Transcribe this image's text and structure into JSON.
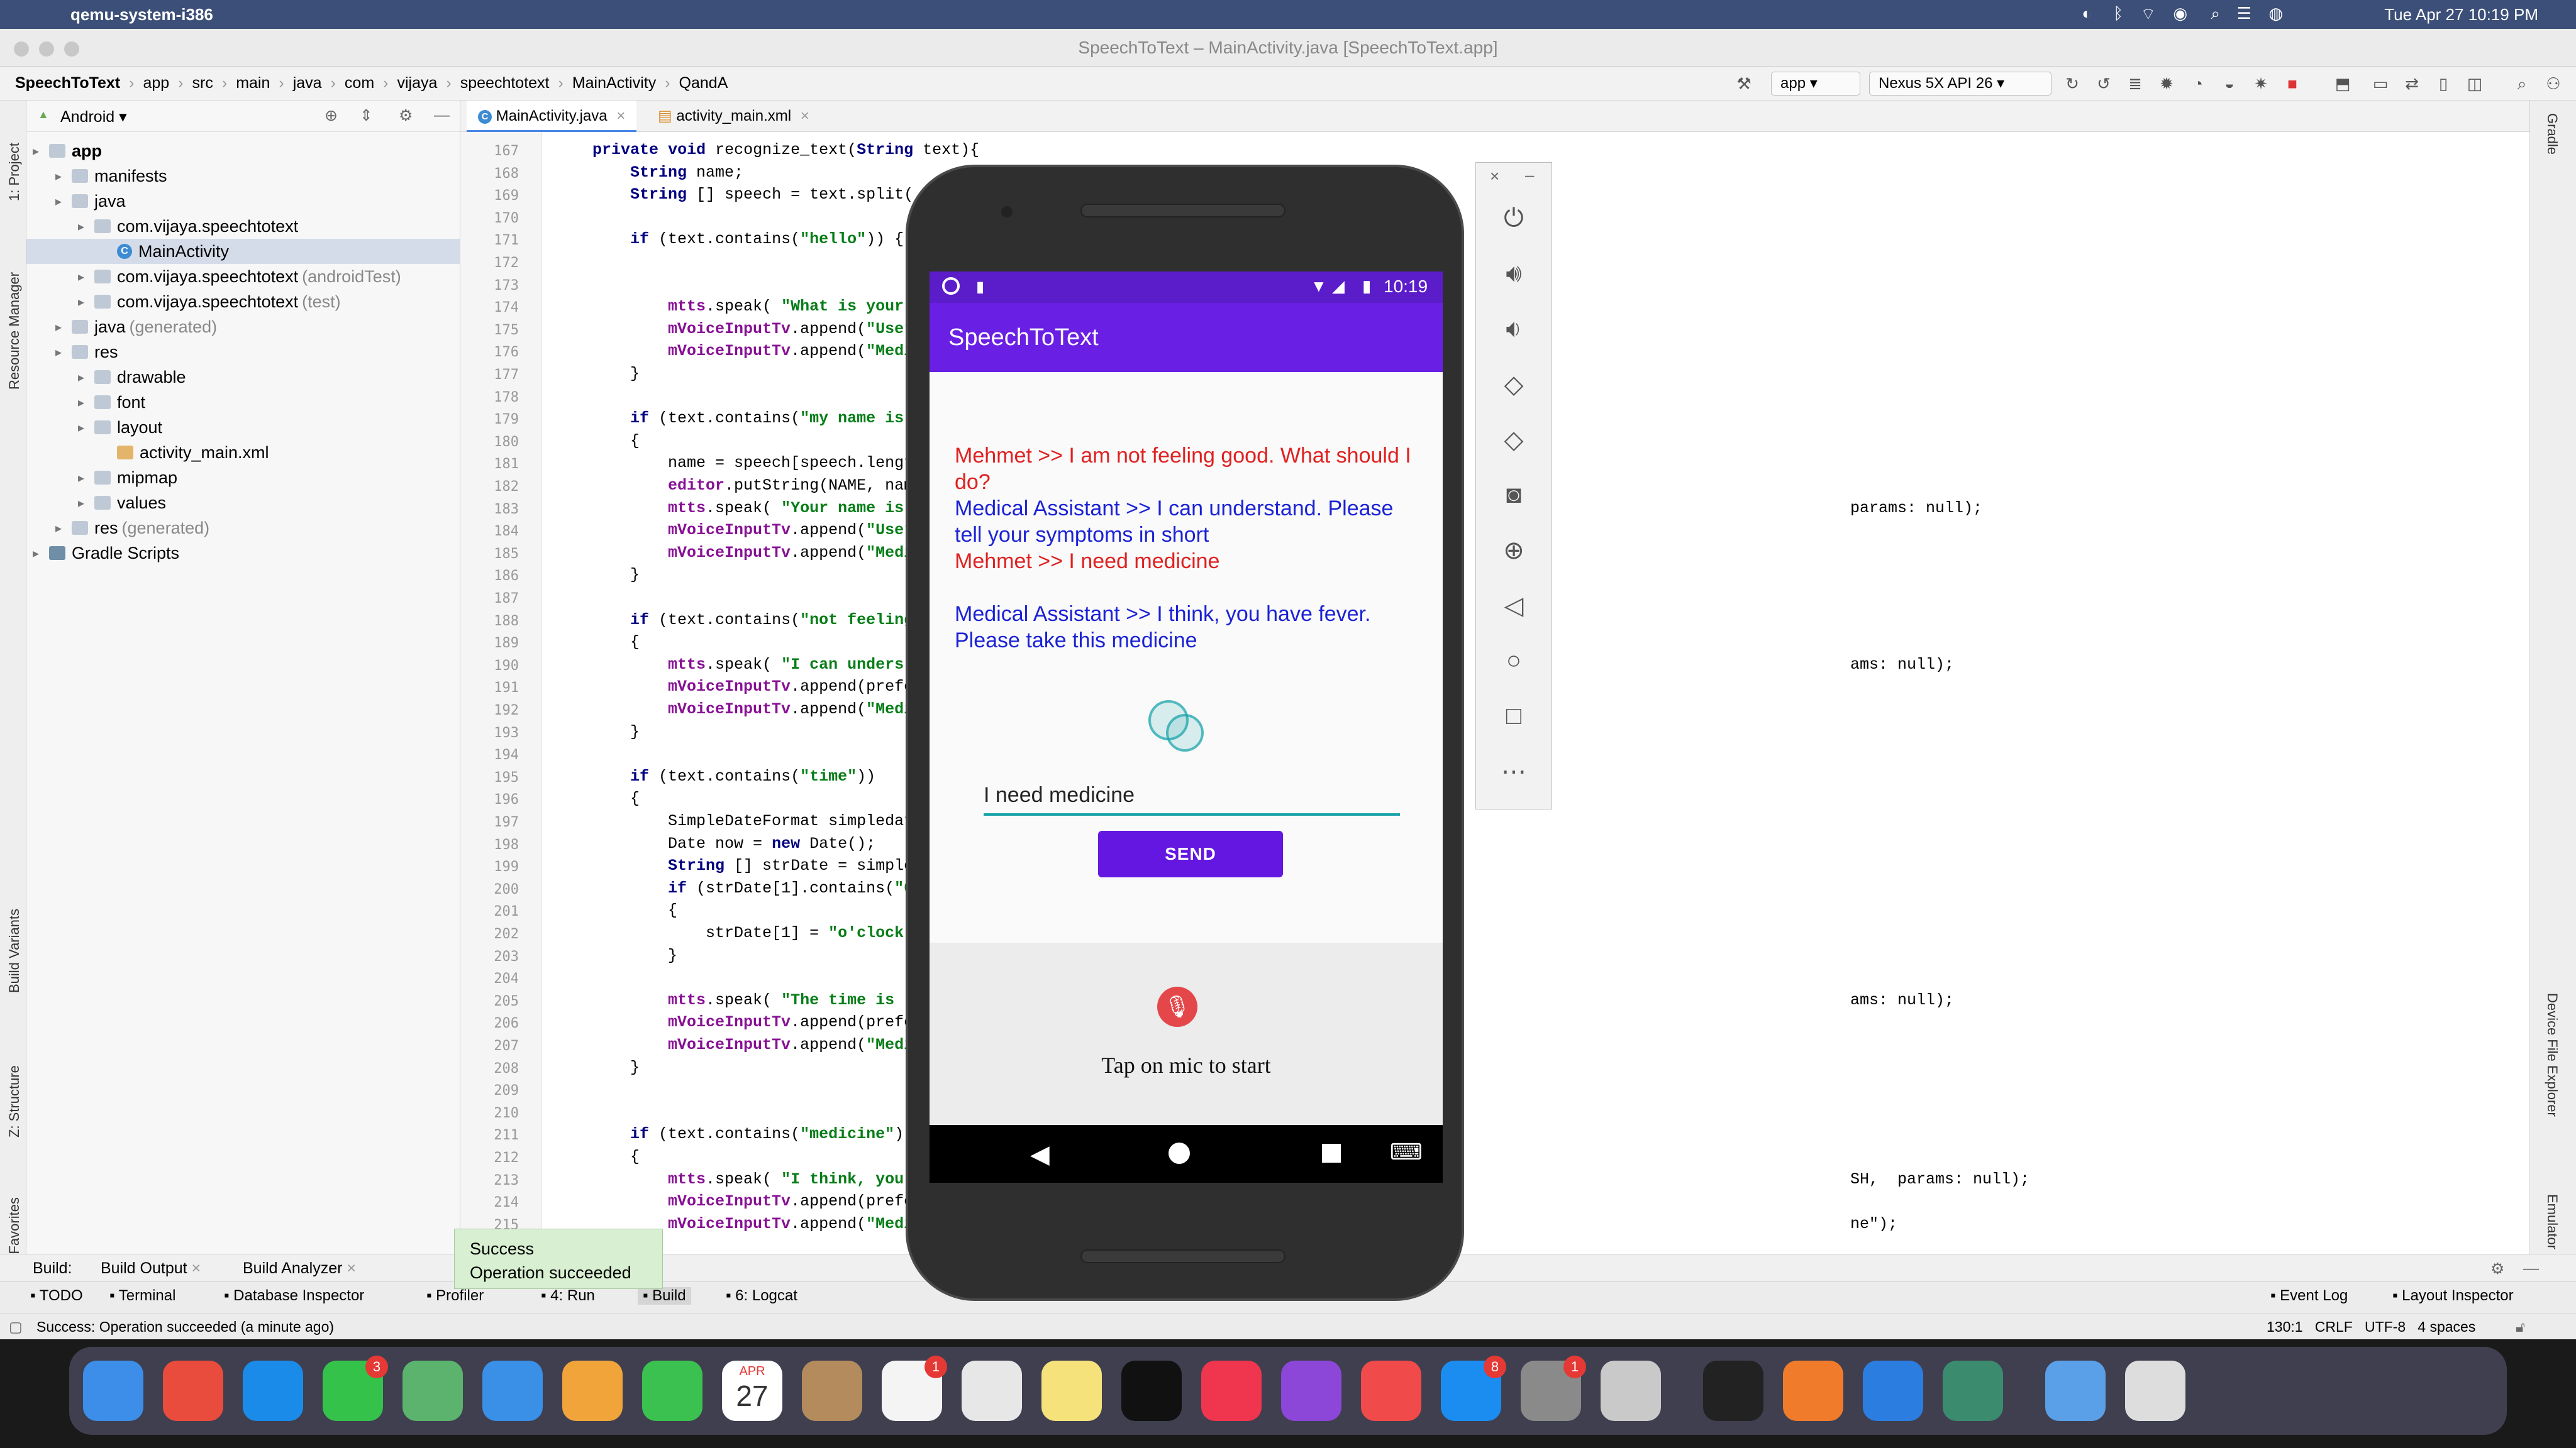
{
  "menubar": {
    "app_name": "qemu-system-i386",
    "clock": "Tue Apr 27  10:19 PM"
  },
  "window": {
    "title": "SpeechToText – MainActivity.java [SpeechToText.app]"
  },
  "breadcrumbs": [
    "SpeechToText",
    "app",
    "src",
    "main",
    "java",
    "com",
    "vijaya",
    "speechtotext",
    "MainActivity",
    "QandA"
  ],
  "toolbar": {
    "run_config": "app",
    "device": "Nexus 5X API 26"
  },
  "left_tabs": [
    "1: Project",
    "Resource Manager",
    "Build Variants",
    "Z: Structure",
    "2: Favorites"
  ],
  "right_tabs": [
    "Gradle",
    "Device File Explorer",
    "Emulator"
  ],
  "project": {
    "view": "Android",
    "tree": [
      {
        "label": "app",
        "extra": "",
        "indent": 0,
        "type": "folder",
        "bold": true
      },
      {
        "label": "manifests",
        "extra": "",
        "indent": 1,
        "type": "folder"
      },
      {
        "label": "java",
        "extra": "",
        "indent": 1,
        "type": "folder"
      },
      {
        "label": "com.vijaya.speechtotext",
        "extra": "",
        "indent": 2,
        "type": "folder"
      },
      {
        "label": "MainActivity",
        "extra": "",
        "indent": 3,
        "type": "class",
        "selected": true
      },
      {
        "label": "com.vijaya.speechtotext",
        "extra": "(androidTest)",
        "indent": 2,
        "type": "folder"
      },
      {
        "label": "com.vijaya.speechtotext",
        "extra": "(test)",
        "indent": 2,
        "type": "folder"
      },
      {
        "label": "java",
        "extra": "(generated)",
        "indent": 1,
        "type": "folder"
      },
      {
        "label": "res",
        "extra": "",
        "indent": 1,
        "type": "folder"
      },
      {
        "label": "drawable",
        "extra": "",
        "indent": 2,
        "type": "folder"
      },
      {
        "label": "font",
        "extra": "",
        "indent": 2,
        "type": "folder"
      },
      {
        "label": "layout",
        "extra": "",
        "indent": 2,
        "type": "folder"
      },
      {
        "label": "activity_main.xml",
        "extra": "",
        "indent": 3,
        "type": "file"
      },
      {
        "label": "mipmap",
        "extra": "",
        "indent": 2,
        "type": "folder"
      },
      {
        "label": "values",
        "extra": "",
        "indent": 2,
        "type": "folder"
      },
      {
        "label": "res",
        "extra": "(generated)",
        "indent": 1,
        "type": "folder"
      },
      {
        "label": "Gradle Scripts",
        "extra": "",
        "indent": 0,
        "type": "gradle"
      }
    ]
  },
  "editor": {
    "tabs": [
      "MainActivity.java",
      "activity_main.xml"
    ],
    "line_numbers": [
      "167",
      "168",
      "169",
      "170",
      "171",
      "172",
      "173",
      "174",
      "175",
      "176",
      "177",
      "178",
      "179",
      "180",
      "181",
      "182",
      "183",
      "184",
      "185",
      "186",
      "187",
      "188",
      "189",
      "190",
      "191",
      "192",
      "193",
      "194",
      "195",
      "196",
      "197",
      "198",
      "199",
      "200",
      "201",
      "202",
      "203",
      "204",
      "205",
      "206",
      "207",
      "208",
      "209",
      "210",
      "211",
      "212",
      "213",
      "214",
      "215"
    ],
    "code_lines": [
      "    private void recognize_text(String text){",
      "        String name;",
      "        String [] speech = text.split(",
      "",
      "        if (text.contains(\"hello\")) {",
      "",
      "",
      "            mtts.speak( \"What is your",
      "            mVoiceInputTv.append(\"User >>",
      "            mVoiceInputTv.append(\"Medical",
      "        }",
      "",
      "        if (text.contains(\"my name is\"))",
      "        {",
      "            name = speech[speech.length-1",
      "            editor.putString(NAME, name).",
      "            mtts.speak( \"Your name is",
      "            mVoiceInputTv.append(\"User >>",
      "            mVoiceInputTv.append(\"Medical",
      "        }",
      "",
      "        if (text.contains(\"not feeling go",
      "        {",
      "            mtts.speak( \"I can unders",
      "            mVoiceInputTv.append(preferen",
      "            mVoiceInputTv.append(\"Medical",
      "        }",
      "",
      "        if (text.contains(\"time\"))",
      "        {",
      "            SimpleDateFormat simpledatefo",
      "            Date now = new Date();",
      "            String [] strDate = simpledat",
      "            if (strDate[1].contains(\"00\")",
      "            {",
      "                strDate[1] = \"o'clock\";",
      "            }",
      "",
      "            mtts.speak( \"The time is",
      "            mVoiceInputTv.append(preferen",
      "            mVoiceInputTv.append(\"Medical",
      "        }",
      "",
      "",
      "        if (text.contains(\"medicine\"))",
      "        {",
      "            mtts.speak( \"I think, you",
      "            mVoiceInputTv.append(preferen",
      "            mVoiceInputTv.append(\"Medical"
    ],
    "right_fragments": [
      {
        "text": "params: null);",
        "line": 16
      },
      {
        "text": "ams: null);",
        "line": 23
      },
      {
        "text": "ams: null);",
        "line": 38
      },
      {
        "text": "SH,  params: null);",
        "line": 46
      },
      {
        "text": "ne\");",
        "line": 48
      }
    ]
  },
  "bottom": {
    "build_label": "Build:",
    "build_tabs": [
      "Build Output",
      "Build Analyzer"
    ],
    "tool_windows": [
      "TODO",
      "Terminal",
      "Database Inspector",
      "Profiler",
      "4: Run",
      "Build",
      "6: Logcat"
    ],
    "right_tools": [
      "Event Log",
      "Layout Inspector"
    ],
    "status_text": "Success: Operation succeeded (a minute ago)",
    "status_right": "130:1   CRLF   UTF-8   4 spaces"
  },
  "toast": {
    "title": "Success",
    "message": "Operation succeeded"
  },
  "emulator": {
    "time": "10:19",
    "app_title": "SpeechToText",
    "messages": [
      {
        "text": "Mehmet >> I am not feeling good. What should I do?",
        "color": "red"
      },
      {
        "text": "Medical Assistant >> I can understand. Please tell your symptoms in short",
        "color": "blue"
      },
      {
        "text": "Mehmet >> I need medicine",
        "color": "red"
      },
      {
        "text": "Medical Assistant >> I think, you have fever. Please take this medicine",
        "color": "blue"
      }
    ],
    "input_value": "I need medicine",
    "send_label": "SEND",
    "mic_text": "Tap on mic to start"
  },
  "emulator_controls": [
    "power-icon",
    "volume-up-icon",
    "volume-down-icon",
    "rotate-left-icon",
    "rotate-right-icon",
    "camera-icon",
    "zoom-icon",
    "back-icon",
    "home-icon",
    "overview-icon",
    "more-icon"
  ],
  "dock": {
    "apps": [
      "Finder",
      "Launchpad",
      "Safari",
      "Messages",
      "Maps",
      "Mail",
      "Photos",
      "FaceTime",
      "Calendar",
      "Contacts",
      "Reminders",
      "Chrome",
      "Notes",
      "TV",
      "Music",
      "Podcasts",
      "News",
      "App Store",
      "System Preferences",
      "QEMU",
      "Terminal",
      "Sublime Text",
      "Xcode Instruments",
      "Android Studio",
      "Downloads",
      "Recent Windows"
    ],
    "calendar_month": "APR",
    "calendar_day": "27",
    "badges": {
      "Messages": "3",
      "Reminders": "1",
      "App Store": "8",
      "System Preferences": "1"
    }
  },
  "colors": {
    "accent": "#6a1fe4",
    "status_bar": "#5b1cc9",
    "send": "#6417e0",
    "user_msg": "#e02020",
    "assistant_msg": "#1b22d4",
    "input_underline": "#17a2a8",
    "mic": "#e4474a"
  }
}
